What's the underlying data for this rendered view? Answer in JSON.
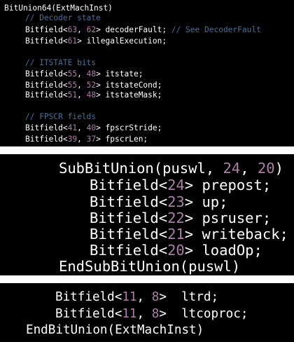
{
  "colors": {
    "background": "#000000",
    "text": "#ffffff",
    "comment": "#4c6f95",
    "number": "#ad7fa8"
  },
  "panels": [
    {
      "lines": [
        {
          "tokens": [
            {
              "t": "BitUnion64(ExtMachInst)",
              "c": "plain"
            }
          ]
        },
        {
          "tokens": [
            {
              "t": "// Decoder state",
              "c": "comment"
            }
          ]
        },
        {
          "tokens": [
            {
              "t": "Bitfield<",
              "c": "plain"
            },
            {
              "t": "63",
              "c": "number"
            },
            {
              "t": ", ",
              "c": "plain"
            },
            {
              "t": "62",
              "c": "number"
            },
            {
              "t": "> decoderFault; ",
              "c": "plain"
            },
            {
              "t": "// See DecoderFault",
              "c": "comment"
            }
          ]
        },
        {
          "tokens": [
            {
              "t": "Bitfield<",
              "c": "plain"
            },
            {
              "t": "61",
              "c": "number"
            },
            {
              "t": "> illegalExecution;",
              "c": "plain"
            }
          ]
        },
        {
          "tokens": [
            {
              "t": "// ITSTATE bits",
              "c": "comment"
            }
          ]
        },
        {
          "tokens": [
            {
              "t": "Bitfield<",
              "c": "plain"
            },
            {
              "t": "55",
              "c": "number"
            },
            {
              "t": ", ",
              "c": "plain"
            },
            {
              "t": "48",
              "c": "number"
            },
            {
              "t": "> itstate;",
              "c": "plain"
            }
          ]
        },
        {
          "tokens": [
            {
              "t": "Bitfield<",
              "c": "plain"
            },
            {
              "t": "55",
              "c": "number"
            },
            {
              "t": ", ",
              "c": "plain"
            },
            {
              "t": "52",
              "c": "number"
            },
            {
              "t": "> itstateCond;",
              "c": "plain"
            }
          ]
        },
        {
          "tokens": [
            {
              "t": "Bitfield<",
              "c": "plain"
            },
            {
              "t": "51",
              "c": "number"
            },
            {
              "t": ", ",
              "c": "plain"
            },
            {
              "t": "48",
              "c": "number"
            },
            {
              "t": "> itstateMask;",
              "c": "plain"
            }
          ]
        },
        {
          "tokens": [
            {
              "t": "// FPSCR fields",
              "c": "comment"
            }
          ]
        },
        {
          "tokens": [
            {
              "t": "Bitfield<",
              "c": "plain"
            },
            {
              "t": "41",
              "c": "number"
            },
            {
              "t": ", ",
              "c": "plain"
            },
            {
              "t": "40",
              "c": "number"
            },
            {
              "t": "> fpscrStride;",
              "c": "plain"
            }
          ]
        },
        {
          "tokens": [
            {
              "t": "Bitfield<",
              "c": "plain"
            },
            {
              "t": "39",
              "c": "number"
            },
            {
              "t": ", ",
              "c": "plain"
            },
            {
              "t": "37",
              "c": "number"
            },
            {
              "t": "> fpscrLen;",
              "c": "plain"
            }
          ]
        }
      ]
    },
    {
      "lines": [
        {
          "tokens": [
            {
              "t": "SubBitUnion(puswl, ",
              "c": "plain"
            },
            {
              "t": "24",
              "c": "number"
            },
            {
              "t": ", ",
              "c": "plain"
            },
            {
              "t": "20",
              "c": "number"
            },
            {
              "t": ")",
              "c": "plain"
            }
          ]
        },
        {
          "tokens": [
            {
              "t": "Bitfield<",
              "c": "plain"
            },
            {
              "t": "24",
              "c": "number"
            },
            {
              "t": "> prepost;",
              "c": "plain"
            }
          ]
        },
        {
          "tokens": [
            {
              "t": "Bitfield<",
              "c": "plain"
            },
            {
              "t": "23",
              "c": "number"
            },
            {
              "t": "> up;",
              "c": "plain"
            }
          ]
        },
        {
          "tokens": [
            {
              "t": "Bitfield<",
              "c": "plain"
            },
            {
              "t": "22",
              "c": "number"
            },
            {
              "t": "> psruser;",
              "c": "plain"
            }
          ]
        },
        {
          "tokens": [
            {
              "t": "Bitfield<",
              "c": "plain"
            },
            {
              "t": "21",
              "c": "number"
            },
            {
              "t": "> writeback;",
              "c": "plain"
            }
          ]
        },
        {
          "tokens": [
            {
              "t": "Bitfield<",
              "c": "plain"
            },
            {
              "t": "20",
              "c": "number"
            },
            {
              "t": "> loadOp;",
              "c": "plain"
            }
          ]
        },
        {
          "tokens": [
            {
              "t": "EndSubBitUnion(puswl)",
              "c": "plain"
            }
          ]
        }
      ]
    },
    {
      "lines": [
        {
          "tokens": [
            {
              "t": "Bitfield<",
              "c": "plain"
            },
            {
              "t": "11",
              "c": "number"
            },
            {
              "t": ", ",
              "c": "plain"
            },
            {
              "t": "8",
              "c": "number"
            },
            {
              "t": ">  ltrd;",
              "c": "plain"
            }
          ]
        },
        {
          "tokens": [
            {
              "t": "Bitfield<",
              "c": "plain"
            },
            {
              "t": "11",
              "c": "number"
            },
            {
              "t": ", ",
              "c": "plain"
            },
            {
              "t": "8",
              "c": "number"
            },
            {
              "t": ">  ltcoproc;",
              "c": "plain"
            }
          ]
        },
        {
          "tokens": [
            {
              "t": "EndBitUnion(ExtMachInst)",
              "c": "plain"
            }
          ]
        }
      ]
    }
  ]
}
